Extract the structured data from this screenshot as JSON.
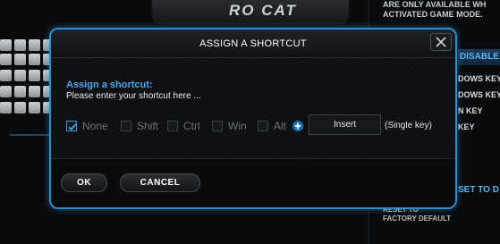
{
  "background": {
    "logo_text": "RO CAT",
    "notice_lines": [
      "ARE ONLY AVAILABLE WH",
      "ACTIVATED GAME MODE."
    ],
    "panel_header": "DISABLE",
    "panel_items": [
      "DOWS KEY",
      "DOWS KEY",
      "N KEY",
      "KEY"
    ],
    "panel_header2": "SET TO D",
    "bottom_lines": [
      "RESET TO",
      "FACTORY DEFAULT"
    ]
  },
  "dialog": {
    "title": "ASSIGN A SHORTCUT",
    "assign_label": "Assign a shortcut:",
    "assign_hint": "Please enter your shortcut here ...",
    "modifiers": [
      {
        "label": "None",
        "checked": true
      },
      {
        "label": "Shift",
        "checked": false
      },
      {
        "label": "Ctrl",
        "checked": false
      },
      {
        "label": "Win",
        "checked": false
      },
      {
        "label": "Alt",
        "checked": false
      }
    ],
    "key_value": "Insert",
    "single_key_note": "(Single key)",
    "ok_label": "OK",
    "cancel_label": "CANCEL"
  },
  "colors": {
    "accent": "#2e8fd0",
    "label_blue": "#4aa8ee",
    "disabled_text": "#6d7075"
  },
  "icons": {
    "close": "close-icon",
    "check": "check-icon",
    "plus": "plus-icon"
  }
}
